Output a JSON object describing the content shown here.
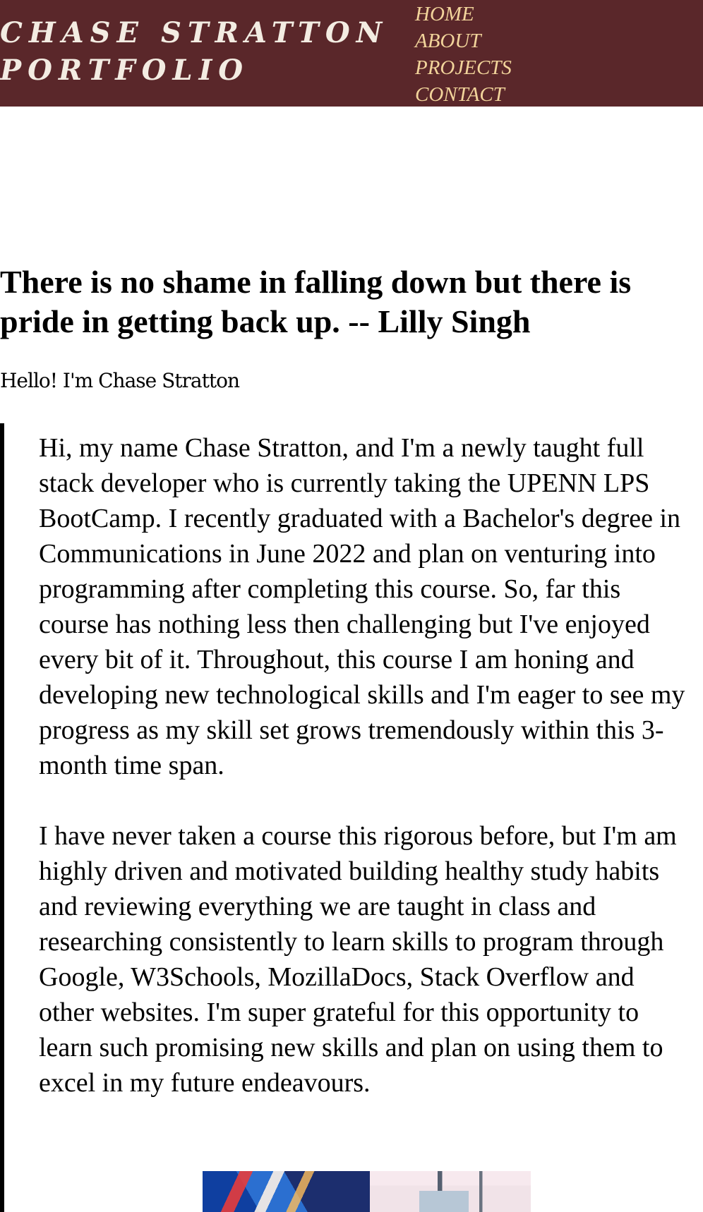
{
  "header": {
    "brand_line1": "CHASE STRATTON",
    "brand_line2": "PORTFOLIO",
    "nav": [
      "HOME",
      "ABOUT",
      "PROJECTS",
      "CONTACT"
    ]
  },
  "hero": {
    "quote": "There is no shame in falling down but there is pride in getting back up. -- Lilly Singh"
  },
  "intro": {
    "greeting": "Hello! I'm Chase Stratton"
  },
  "about": {
    "paragraphs": [
      "Hi, my name Chase Stratton, and I'm a newly taught full stack developer who is currently taking the UPENN LPS BootCamp. I recently graduated with a Bachelor's degree in Communications in June 2022 and plan on venturing into programming after completing this course. So, far this course has nothing less then challenging but I've enjoyed every bit of it. Throughout, this course I am honing and developing new technological skills and I'm eager to see my progress as my skill set grows tremendously within this 3-month time span.",
      "I have never taken a course this rigorous before, but I'm am highly driven and motivated building healthy study habits and reviewing everything we are taught in class and researching consistently to learn skills to program through Google, W3Schools, MozillaDocs, Stack Overflow and other websites. I'm super grateful for this opportunity to learn such promising new skills and plan on using them to excel in my future endeavours."
    ]
  },
  "colors": {
    "header_bg": "#5a272a",
    "brand_text": "#f3ece2",
    "nav_text": "#f2d49b"
  }
}
